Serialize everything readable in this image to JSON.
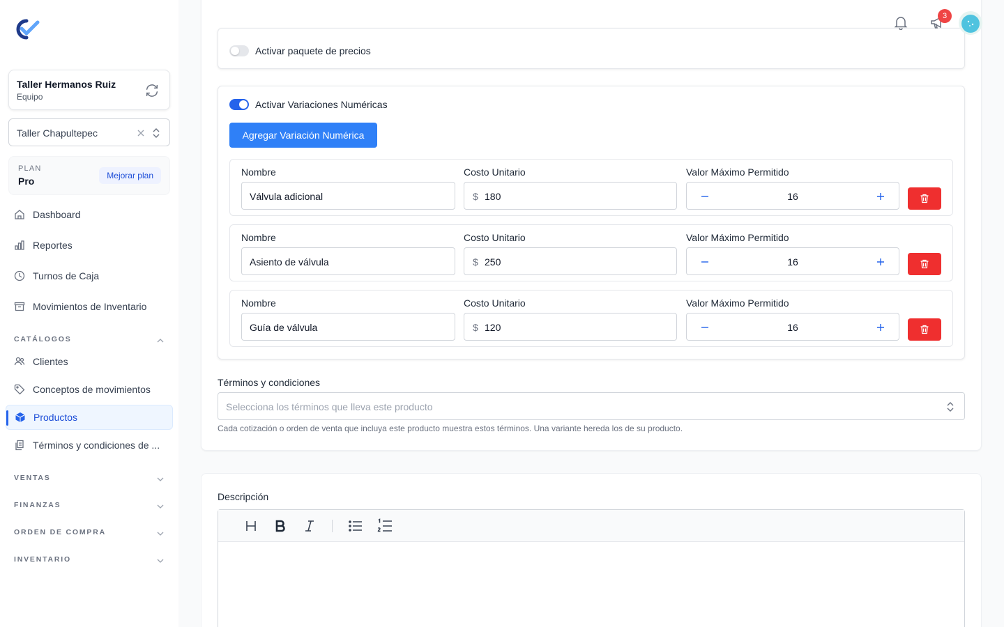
{
  "team": {
    "name": "Taller Hermanos Ruiz",
    "role": "Equipo"
  },
  "branch": {
    "value": "Taller Chapultepec"
  },
  "plan": {
    "label": "PLAN",
    "value": "Pro",
    "upgrade_label": "Mejorar plan"
  },
  "nav": {
    "dashboard": "Dashboard",
    "reports": "Reportes",
    "shifts": "Turnos de Caja",
    "inventory_moves": "Movimientos de Inventario",
    "catalogs": "CATÁLOGOS",
    "clients": "Clientes",
    "movement_concepts": "Conceptos de movimientos",
    "products": "Productos",
    "terms": "Términos y condiciones de ...",
    "sales": "VENTAS",
    "finance": "FINANZAS",
    "purchase_orders": "ORDEN DE COMPRA",
    "inventory": "INVENTARIO"
  },
  "topbar": {
    "notifications_badge": "3"
  },
  "pricing_package": {
    "label": "Activar paquete de precios",
    "enabled": false
  },
  "numeric_variations": {
    "label": "Activar Variaciones Numéricas",
    "enabled": true,
    "add_label": "Agregar Variación Numérica",
    "labels": {
      "name": "Nombre",
      "unit_cost": "Costo Unitario",
      "max_value": "Valor Máximo Permitido"
    },
    "currency_symbol": "$",
    "rows": [
      {
        "name": "Válvula adicional",
        "unit_cost": "180",
        "max_value": "16"
      },
      {
        "name": "Asiento de válvula",
        "unit_cost": "250",
        "max_value": "16"
      },
      {
        "name": "Guía de válvula",
        "unit_cost": "120",
        "max_value": "16"
      }
    ]
  },
  "terms": {
    "label": "Términos y condiciones",
    "placeholder": "Selecciona los términos que lleva este producto",
    "help": "Cada cotización o orden de venta que incluya este producto muestra estos términos. Una variante hereda los de su producto."
  },
  "description": {
    "label": "Descripción"
  },
  "colors": {
    "primary": "#2f80f7",
    "danger": "#ef2f2f",
    "active_nav_bg": "#eff6ff"
  }
}
